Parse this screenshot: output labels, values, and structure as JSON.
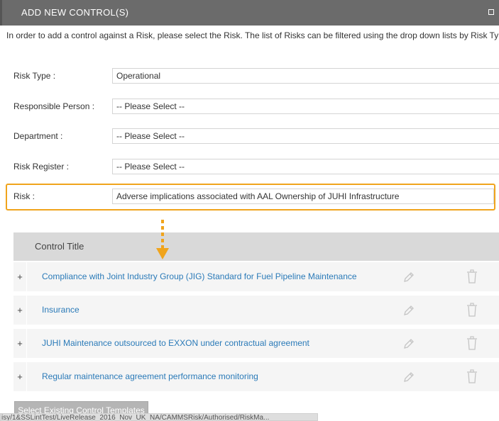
{
  "dialog": {
    "title": "ADD NEW CONTROL(S)",
    "intro": "In order to add a control against a Risk, please select the Risk. The list of Risks can be filtered using the drop down lists by Risk Typ"
  },
  "form": {
    "risk_type": {
      "label": "Risk Type :",
      "value": "Operational"
    },
    "responsible_person": {
      "label": "Responsible Person :",
      "value": "-- Please Select --"
    },
    "department": {
      "label": "Department :",
      "value": "-- Please Select --"
    },
    "risk_register": {
      "label": "Risk Register :",
      "value": "-- Please Select --"
    },
    "risk": {
      "label": "Risk :",
      "value": "Adverse implications associated with AAL Ownership of JUHI Infrastructure"
    }
  },
  "controls_table": {
    "header": "Control Title",
    "rows": [
      {
        "expand": "+",
        "title": "Compliance with Joint Industry Group (JIG) Standard for Fuel Pipeline Maintenance"
      },
      {
        "expand": "+",
        "title": "Insurance"
      },
      {
        "expand": "+",
        "title": "JUHI Maintenance outsourced to EXXON under contractual agreement"
      },
      {
        "expand": "+",
        "title": "Regular maintenance agreement performance monitoring"
      }
    ]
  },
  "buttons": {
    "select_templates": "Select Existing Control Templates"
  },
  "status_bar": {
    "url": "isy/1&SSLintTest/LiveRelease_2016_Nov_UK_NA/CAMMSRisk/Authorised/RiskMa..."
  },
  "colors": {
    "titlebar": "#6b6b6b",
    "highlight": "#f0a41c",
    "link": "#2a7ab8",
    "table_header": "#d9d9d9",
    "row_bg": "#f5f5f5"
  },
  "icons": [
    "maximize-icon",
    "pencil-icon",
    "trash-icon",
    "arrow-down-icon"
  ]
}
